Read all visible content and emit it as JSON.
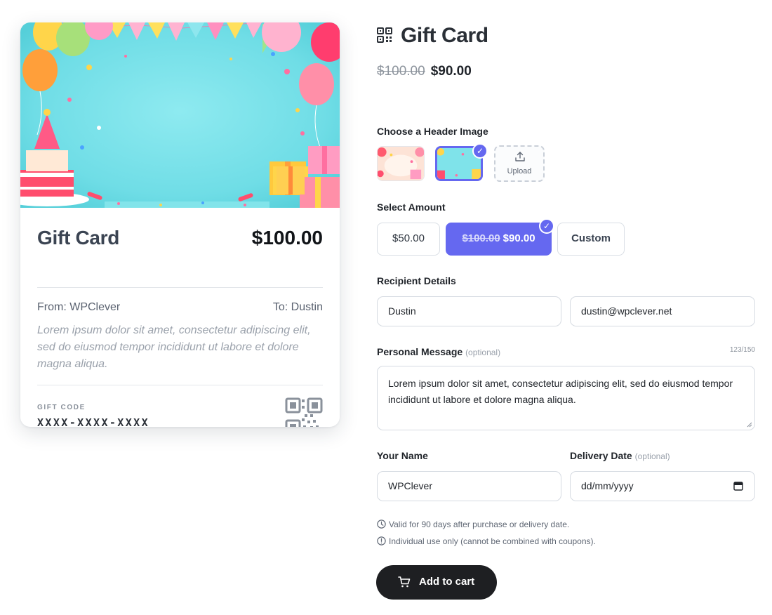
{
  "card": {
    "title": "Gift Card",
    "price": "$100.00",
    "from": "From: WPClever",
    "to": "To: Dustin",
    "message": "Lorem ipsum dolor sit amet, consectetur adipiscing elit, sed do eiusmod tempor incididunt ut labore et dolore magna aliqua.",
    "code_label": "GIFT CODE",
    "code_value": "XXXX-XXXX-XXXX",
    "image_icon": "birthday-party-image"
  },
  "product": {
    "icon": "qr-code-icon",
    "title": "Gift Card",
    "price_old": "$100.00",
    "price_new": "$90.00"
  },
  "header_image": {
    "label": "Choose a Header Image",
    "selected_index": 1,
    "upload_label": "Upload"
  },
  "amount": {
    "label": "Select Amount",
    "options": [
      {
        "label": "$50.00"
      },
      {
        "label_old": "$100.00",
        "label": "$90.00",
        "selected": true
      },
      {
        "label": "Custom"
      }
    ]
  },
  "recipient": {
    "label": "Recipient Details",
    "name": "Dustin",
    "email": "dustin@wpclever.net"
  },
  "message": {
    "label": "Personal Message",
    "optional": "(optional)",
    "counter": "123/150",
    "value": "Lorem ipsum dolor sit amet, consectetur adipiscing elit, sed do eiusmod tempor incididunt ut labore et dolore magna aliqua."
  },
  "sender": {
    "label": "Your Name",
    "value": "WPClever"
  },
  "delivery": {
    "label": "Delivery Date",
    "optional": "(optional)",
    "placeholder": "dd/mm/yyyy"
  },
  "notes": [
    {
      "icon": "clock-icon",
      "text": "Valid for 90 days after purchase or delivery date."
    },
    {
      "icon": "info-icon",
      "text": "Individual use only (cannot be combined with coupons)."
    }
  ],
  "cart": {
    "icon": "cart-icon",
    "label": "Add to cart"
  },
  "colors": {
    "accent": "#6568f0",
    "dark_button": "#1e1f22",
    "image_background": "#7fe3ea"
  }
}
